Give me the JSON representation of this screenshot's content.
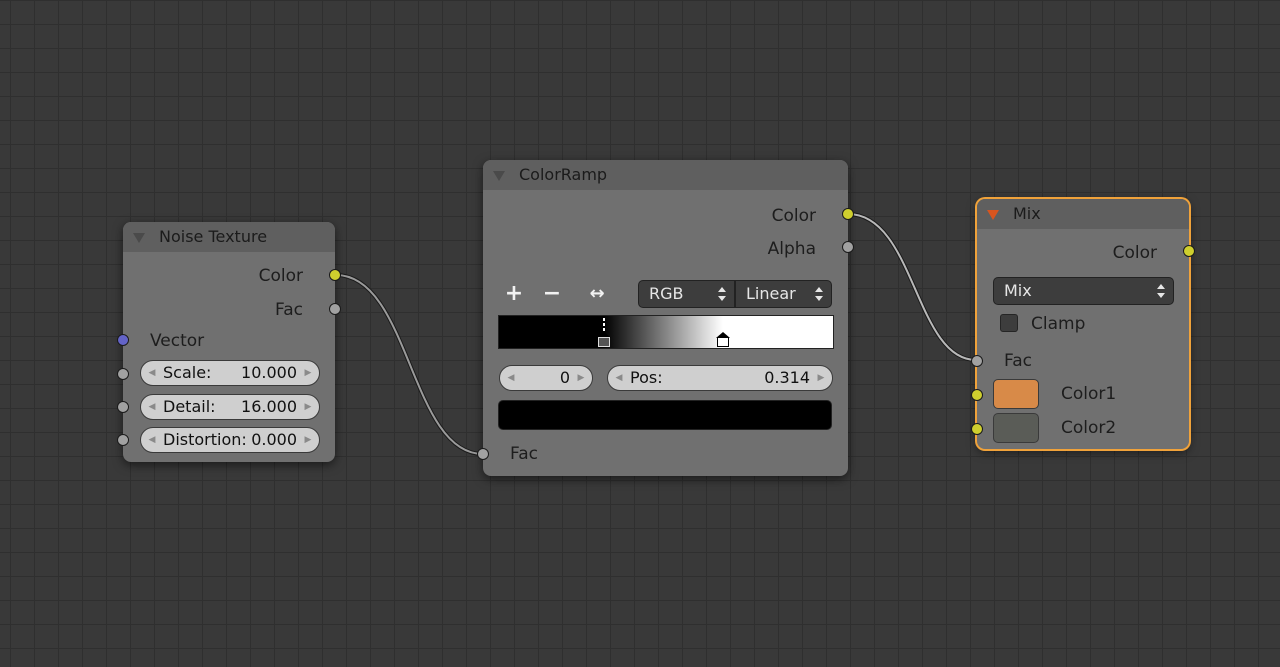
{
  "nodes": {
    "noise": {
      "title": "Noise Texture",
      "outputs": {
        "color": "Color",
        "fac": "Fac"
      },
      "inputs": {
        "vector": "Vector"
      },
      "scale": {
        "label": "Scale:",
        "value": "10.000"
      },
      "detail": {
        "label": "Detail:",
        "value": "16.000"
      },
      "distortion": {
        "label": "Distortion:",
        "value": "0.000"
      }
    },
    "colorramp": {
      "title": "ColorRamp",
      "outputs": {
        "color": "Color",
        "alpha": "Alpha"
      },
      "tools": {
        "add": "+",
        "remove": "−",
        "flip": "↔"
      },
      "color_mode": "RGB",
      "interpolation": "Linear",
      "active_stop": "0",
      "pos": {
        "label": "Pos:",
        "value": "0.314"
      },
      "stops": [
        0.314,
        0.67
      ],
      "stop_color": "#000000",
      "inputs": {
        "fac": "Fac"
      }
    },
    "mix": {
      "title": "Mix",
      "outputs": {
        "color": "Color"
      },
      "blend_type": "Mix",
      "clamp_label": "Clamp",
      "clamp_checked": false,
      "inputs": {
        "fac": "Fac",
        "color1": "Color1",
        "color2": "Color2"
      },
      "color1_value": "#d88a48",
      "color2_value": "#5a5c57"
    }
  },
  "colors": {
    "background": "#393939",
    "socket_color": "#cfcf2e",
    "socket_float": "#a1a1a1",
    "socket_vector": "#6363c7",
    "selection_outline": "#f0a23a"
  }
}
